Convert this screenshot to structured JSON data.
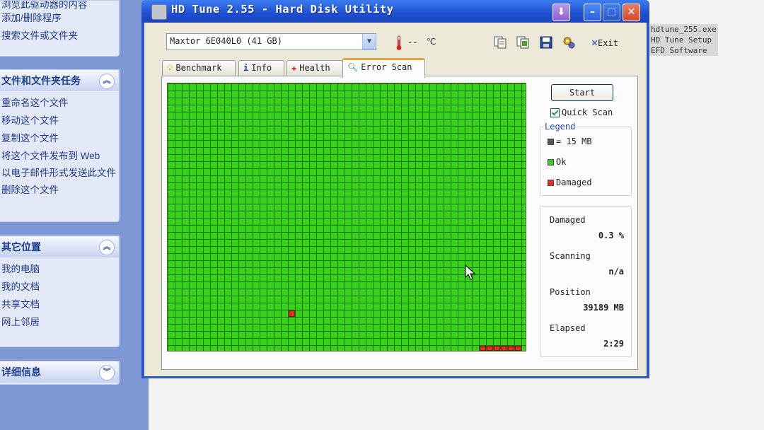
{
  "explorer": {
    "top_items": [
      "添加/删除程序",
      "搜索文件或文件夹"
    ],
    "top_cutoff_item": "浏览此驱动器的内容",
    "file_tasks": {
      "title": "文件和文件夹任务",
      "items": [
        "重命名这个文件",
        "移动这个文件",
        "复制这个文件",
        "将这个文件发布到 Web",
        "以电子邮件形式发送此文件",
        "删除这个文件"
      ]
    },
    "other_places": {
      "title": "其它位置",
      "items": [
        "我的电脑",
        "我的文档",
        "共享文档",
        "网上邻居"
      ]
    },
    "details": {
      "title": "详细信息"
    }
  },
  "file_list": [
    "hdtune_255.exe",
    "HD Tune Setup",
    "EFD Software"
  ],
  "app": {
    "title": "HD Tune 2.55 - Hard Disk Utility",
    "drive": "Maxtor 6E040L0 (41 GB)",
    "temperature": "--",
    "temp_unit": "℃",
    "exit_label": "Exit",
    "tabs": [
      "Benchmark",
      "Info",
      "Health",
      "Error Scan"
    ],
    "active_tab": "Error Scan"
  },
  "scan": {
    "start_label": "Start",
    "quick_scan_label": "Quick Scan",
    "quick_scan_checked": true,
    "legend": {
      "title": "Legend",
      "block_size": "= 15 MB",
      "ok": "Ok",
      "damaged": "Damaged"
    },
    "stats": {
      "damaged_label": "Damaged",
      "damaged_value": "0.3 %",
      "scanning_label": "Scanning",
      "scanning_value": "n/a",
      "position_label": "Position",
      "position_value": "39189 MB",
      "elapsed_label": "Elapsed",
      "elapsed_value": "2:29"
    },
    "grid": {
      "columns": 50,
      "rows": 38,
      "damaged_blocks": 7
    },
    "colors": {
      "ok": "#37d117",
      "damaged": "#e03020",
      "grid_line": "#0a3c05"
    }
  }
}
